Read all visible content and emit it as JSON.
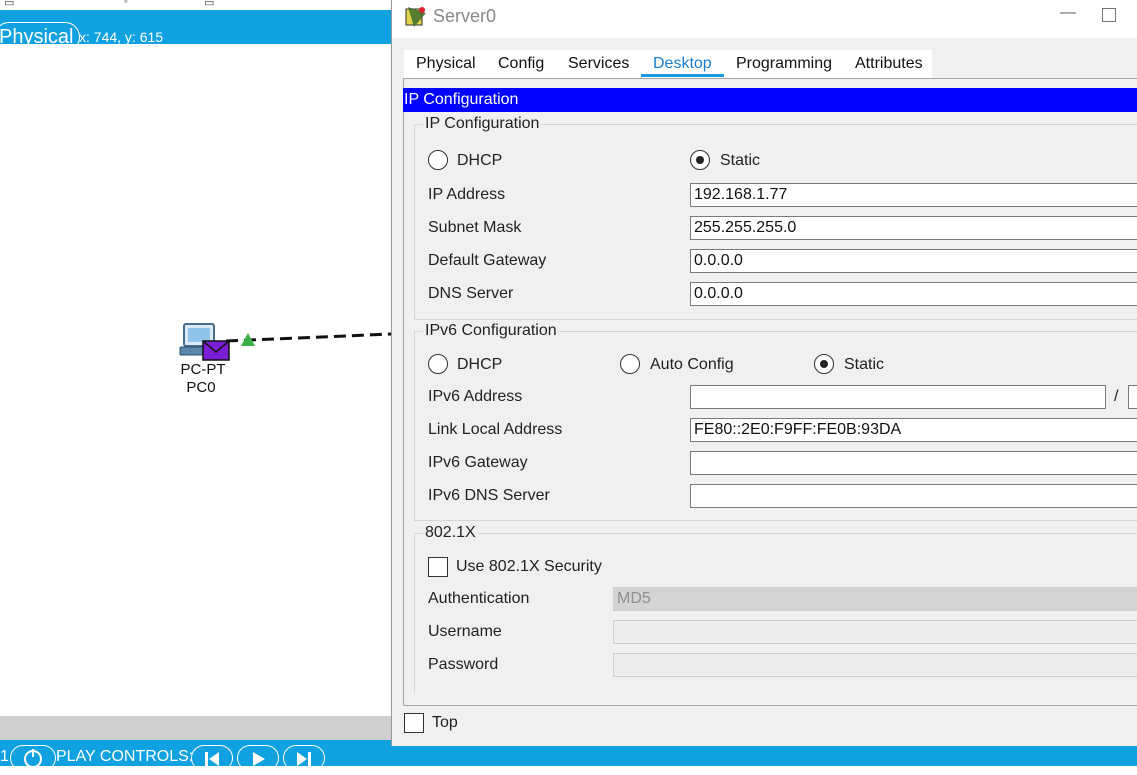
{
  "workspace": {
    "mode_button": "Physical",
    "coords": "x: 744, y: 615",
    "pc_type": "PC-PT",
    "pc_name": "PC0",
    "realtime_num": "1",
    "play_controls_label": "PLAY CONTROLS:",
    "colors": {
      "bar": "#0fa1e0",
      "link": "#111111",
      "link_up": "#3cb043",
      "pdu": "#7a1fd6"
    }
  },
  "window": {
    "title": "Server0",
    "minimize_glyph": "—",
    "icons": [
      "server-icon",
      "minimize-icon",
      "maximize-icon"
    ]
  },
  "tabs": [
    {
      "label": "Physical",
      "active": false
    },
    {
      "label": "Config",
      "active": false
    },
    {
      "label": "Services",
      "active": false
    },
    {
      "label": "Desktop",
      "active": true
    },
    {
      "label": "Programming",
      "active": false
    },
    {
      "label": "Attributes",
      "active": false
    }
  ],
  "section_header": "IP Configuration",
  "ipv4": {
    "group_title": "IP Configuration",
    "dhcp_label": "DHCP",
    "static_label": "Static",
    "selected": "Static",
    "fields": [
      {
        "label": "IP Address",
        "value": "192.168.1.77"
      },
      {
        "label": "Subnet Mask",
        "value": "255.255.255.0"
      },
      {
        "label": "Default Gateway",
        "value": "0.0.0.0"
      },
      {
        "label": "DNS Server",
        "value": "0.0.0.0"
      }
    ]
  },
  "ipv6": {
    "group_title": "IPv6 Configuration",
    "dhcp_label": "DHCP",
    "auto_label": "Auto Config",
    "static_label": "Static",
    "selected": "Static",
    "prefix_separator": "/",
    "fields": [
      {
        "label": "IPv6 Address",
        "value": ""
      },
      {
        "label": "Link Local Address",
        "value": "FE80::2E0:F9FF:FE0B:93DA"
      },
      {
        "label": "IPv6 Gateway",
        "value": ""
      },
      {
        "label": "IPv6 DNS Server",
        "value": ""
      }
    ]
  },
  "dot1x": {
    "group_title": "802.1X",
    "use_label": "Use 802.1X Security",
    "use_checked": false,
    "auth_label": "Authentication",
    "auth_value": "MD5",
    "username_label": "Username",
    "username_value": "",
    "password_label": "Password",
    "password_value": ""
  },
  "footer": {
    "top_label": "Top",
    "top_checked": false
  }
}
